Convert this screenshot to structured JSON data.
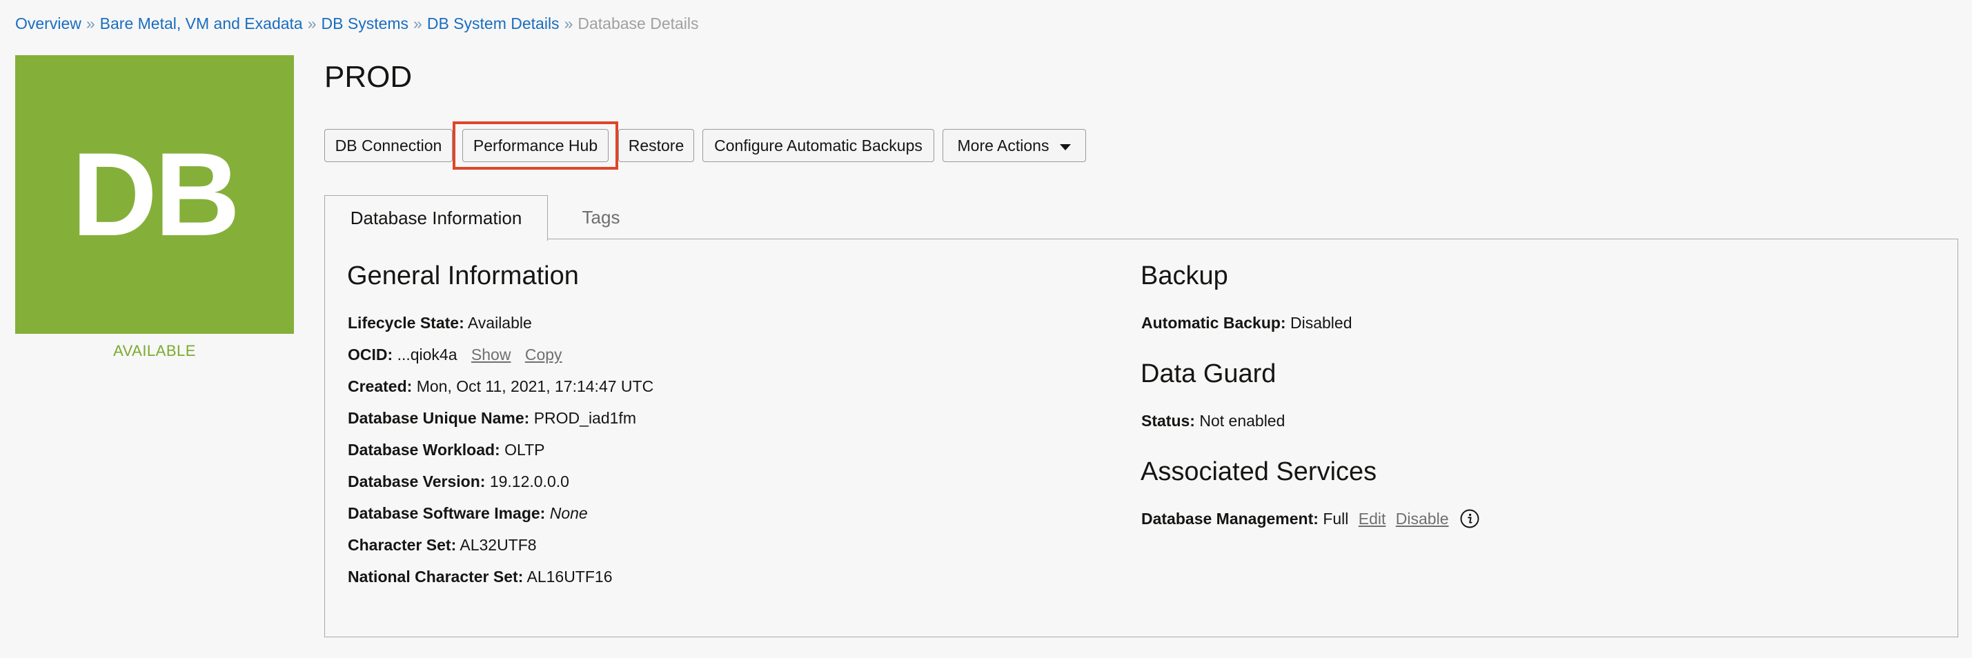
{
  "breadcrumb": {
    "items": [
      "Overview",
      "Bare Metal, VM and Exadata",
      "DB Systems",
      "DB System Details"
    ],
    "separator": "»",
    "current": "Database Details"
  },
  "tile": {
    "label": "DB",
    "color": "#84b03a"
  },
  "status": {
    "label": "AVAILABLE",
    "color": "#7aab2f"
  },
  "page_title": "PROD",
  "toolbar": {
    "db_connection": "DB Connection",
    "performance_hub": "Performance Hub",
    "restore": "Restore",
    "configure_backups": "Configure Automatic Backups",
    "more_actions": "More Actions",
    "highlight_color": "#e0452a"
  },
  "tabs": {
    "database_information": "Database Information",
    "tags": "Tags"
  },
  "general_information": {
    "title": "General Information",
    "lifecycle_state": {
      "label": "Lifecycle State:",
      "value": "Available"
    },
    "ocid": {
      "label": "OCID:",
      "value": "...qiok4a",
      "show": "Show",
      "copy": "Copy"
    },
    "created": {
      "label": "Created:",
      "value": "Mon, Oct 11, 2021, 17:14:47 UTC"
    },
    "unique_name": {
      "label": "Database Unique Name:",
      "value": "PROD_iad1fm"
    },
    "workload": {
      "label": "Database Workload:",
      "value": "OLTP"
    },
    "version": {
      "label": "Database Version:",
      "value": "19.12.0.0.0"
    },
    "software_image": {
      "label": "Database Software Image:",
      "value": "None"
    },
    "character_set": {
      "label": "Character Set:",
      "value": "AL32UTF8"
    },
    "national_character_set": {
      "label": "National Character Set:",
      "value": "AL16UTF16"
    }
  },
  "backup": {
    "title": "Backup",
    "automatic_backup": {
      "label": "Automatic Backup:",
      "value": "Disabled"
    }
  },
  "data_guard": {
    "title": "Data Guard",
    "status": {
      "label": "Status:",
      "value": "Not enabled"
    }
  },
  "associated_services": {
    "title": "Associated Services",
    "database_management": {
      "label": "Database Management:",
      "value": "Full",
      "edit": "Edit",
      "disable": "Disable"
    },
    "info_icon": "info-icon"
  }
}
